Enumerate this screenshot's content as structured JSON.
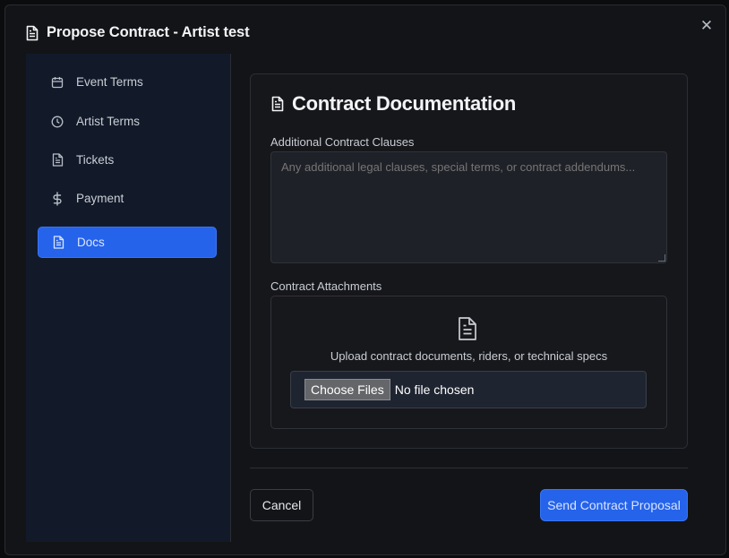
{
  "dialog": {
    "title": "Propose Contract - Artist test",
    "title_icon": "document-icon",
    "close_icon": "close-icon",
    "close_glyph": "✕"
  },
  "sidebar": {
    "items": [
      {
        "label": "Event Terms",
        "icon": "calendar-icon",
        "active": false
      },
      {
        "label": "Artist Terms",
        "icon": "clock-icon",
        "active": false
      },
      {
        "label": "Tickets",
        "icon": "document-icon",
        "active": false
      },
      {
        "label": "Payment",
        "icon": "dollar-icon",
        "active": false
      },
      {
        "label": "Docs",
        "icon": "document-icon",
        "active": true
      }
    ]
  },
  "main": {
    "section_title": "Contract Documentation",
    "clauses": {
      "label": "Additional Contract Clauses",
      "value": "",
      "placeholder": "Any additional legal clauses, special terms, or contract addendums..."
    },
    "attachments": {
      "label": "Contract Attachments",
      "upload_icon": "file-icon",
      "hint": "Upload contract documents, riders, or technical specs",
      "choose_label": "Choose Files",
      "status": "No file chosen"
    }
  },
  "footer": {
    "cancel_label": "Cancel",
    "send_label": "Send Contract Proposal"
  },
  "colors": {
    "accent": "#2563eb",
    "background": "#131417",
    "sidebar": "#121a2a"
  }
}
